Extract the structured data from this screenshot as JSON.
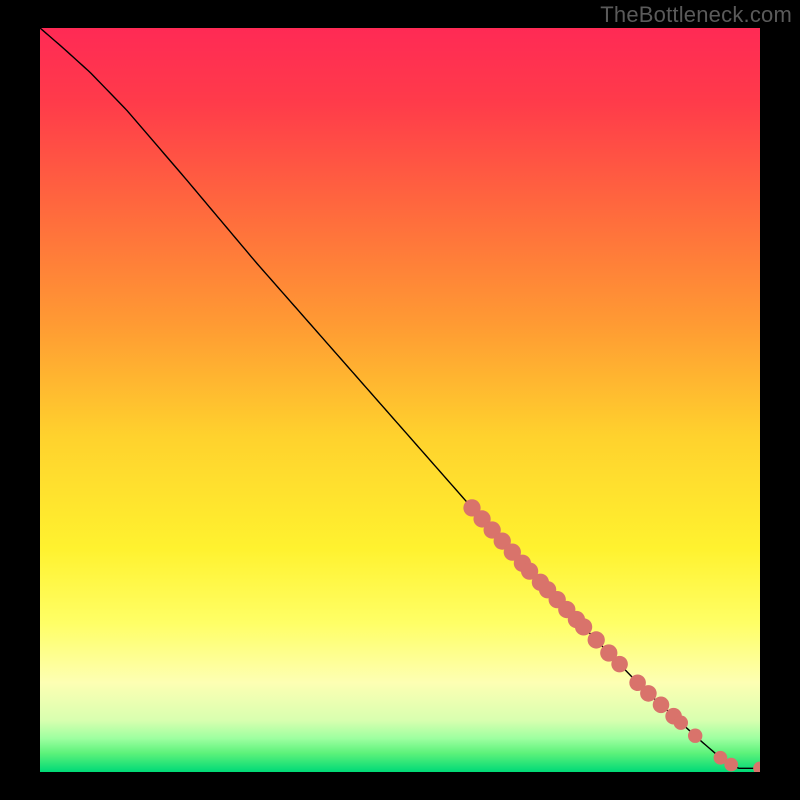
{
  "watermark": "TheBottleneck.com",
  "colors": {
    "background": "#000000",
    "watermark_text": "#5a5a5a",
    "curve_stroke": "#000000",
    "dot_fill": "#d9736b",
    "green_band_top": "#5cf27a",
    "green_band_bottom": "#00d977"
  },
  "chart_data": {
    "type": "line",
    "title": "",
    "xlabel": "",
    "ylabel": "",
    "xlim": [
      0,
      100
    ],
    "ylim": [
      0,
      100
    ],
    "gradient_stops": [
      {
        "offset": 0.0,
        "color": "#ff2a55"
      },
      {
        "offset": 0.1,
        "color": "#ff3b4a"
      },
      {
        "offset": 0.25,
        "color": "#ff6b3d"
      },
      {
        "offset": 0.4,
        "color": "#ff9b33"
      },
      {
        "offset": 0.55,
        "color": "#ffd22d"
      },
      {
        "offset": 0.7,
        "color": "#fff22f"
      },
      {
        "offset": 0.8,
        "color": "#ffff66"
      },
      {
        "offset": 0.88,
        "color": "#fdffb3"
      },
      {
        "offset": 0.93,
        "color": "#d9ffb0"
      },
      {
        "offset": 0.955,
        "color": "#9dffa0"
      },
      {
        "offset": 0.975,
        "color": "#5cf27a"
      },
      {
        "offset": 1.0,
        "color": "#00d977"
      }
    ],
    "curve": {
      "x": [
        0.0,
        3.0,
        7.0,
        12.0,
        20.0,
        30.0,
        40.0,
        50.0,
        60.0,
        68.0,
        72.0,
        76.0,
        80.0,
        84.0,
        88.0,
        92.0,
        95.0,
        97.0,
        100.0
      ],
      "y": [
        100.0,
        97.5,
        94.0,
        89.0,
        80.0,
        68.5,
        57.5,
        46.5,
        35.5,
        27.0,
        23.0,
        19.0,
        15.0,
        11.0,
        7.5,
        4.0,
        1.5,
        0.5,
        0.5
      ]
    },
    "dot_clusters": [
      {
        "x_start": 60.0,
        "x_end": 67.0,
        "count": 6,
        "radius": 1.2
      },
      {
        "x_start": 68.0,
        "x_end": 69.5,
        "count": 2,
        "radius": 1.2
      },
      {
        "x_start": 70.5,
        "x_end": 74.5,
        "count": 4,
        "radius": 1.2
      },
      {
        "x_start": 75.5,
        "x_end": 79.0,
        "count": 3,
        "radius": 1.2
      },
      {
        "x_start": 80.5,
        "x_end": 83.0,
        "count": 2,
        "radius": 1.15
      },
      {
        "x_start": 84.5,
        "x_end": 88.0,
        "count": 3,
        "radius": 1.15
      },
      {
        "x_start": 89.0,
        "x_end": 89.5,
        "count": 1,
        "radius": 1.0
      },
      {
        "x_start": 91.0,
        "x_end": 91.5,
        "count": 1,
        "radius": 1.0
      },
      {
        "x_start": 94.5,
        "x_end": 96.0,
        "count": 2,
        "radius": 0.95
      },
      {
        "x_start": 100.0,
        "x_end": 100.0,
        "count": 1,
        "radius": 0.95
      }
    ]
  }
}
